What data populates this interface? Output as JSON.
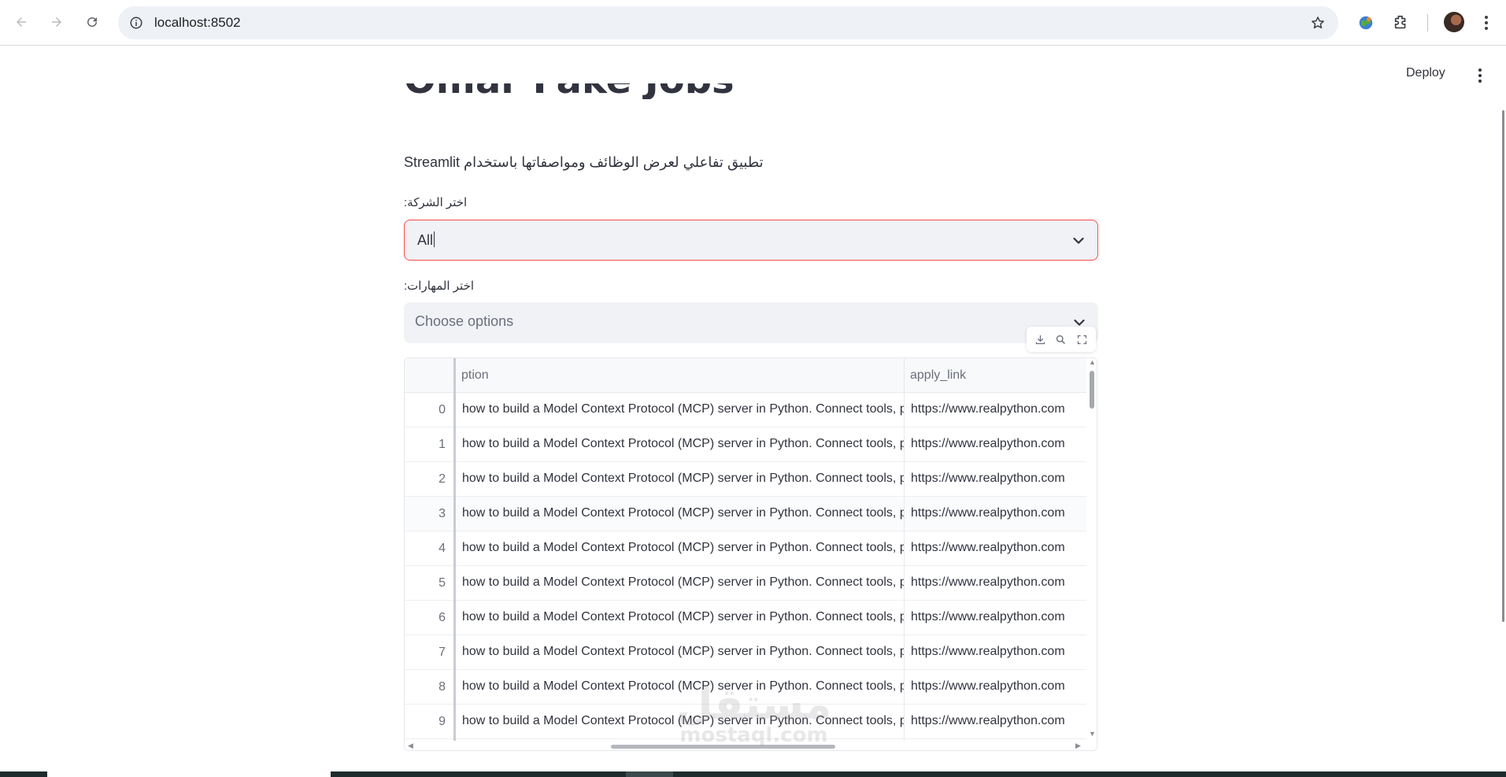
{
  "browser": {
    "url": "localhost:8502",
    "nav": {
      "back_icon": "arrow-left-icon",
      "forward_icon": "arrow-right-icon",
      "reload_icon": "reload-icon"
    }
  },
  "app_header": {
    "deploy_label": "Deploy"
  },
  "main": {
    "title": "Omar Fake Jobs",
    "subtitle": "تطبيق تفاعلي لعرض الوظائف ومواصفاتها باستخدام Streamlit",
    "company_select": {
      "label": ":اختر الشركة",
      "value": "All"
    },
    "skills_select": {
      "label": ":اختر المهارات",
      "placeholder": "Choose options"
    }
  },
  "dataframe": {
    "toolbar": [
      "download-icon",
      "search-icon",
      "fullscreen-icon"
    ],
    "columns": [
      "ption",
      "apply_link"
    ],
    "rows": [
      {
        "index": "0",
        "description": "how to build a Model Context Protocol (MCP) server in Python. Connect tools, p",
        "apply_link": "https://www.realpython.com"
      },
      {
        "index": "1",
        "description": "how to build a Model Context Protocol (MCP) server in Python. Connect tools, p",
        "apply_link": "https://www.realpython.com"
      },
      {
        "index": "2",
        "description": "how to build a Model Context Protocol (MCP) server in Python. Connect tools, p",
        "apply_link": "https://www.realpython.com"
      },
      {
        "index": "3",
        "description": "how to build a Model Context Protocol (MCP) server in Python. Connect tools, p",
        "apply_link": "https://www.realpython.com"
      },
      {
        "index": "4",
        "description": "how to build a Model Context Protocol (MCP) server in Python. Connect tools, p",
        "apply_link": "https://www.realpython.com"
      },
      {
        "index": "5",
        "description": "how to build a Model Context Protocol (MCP) server in Python. Connect tools, p",
        "apply_link": "https://www.realpython.com"
      },
      {
        "index": "6",
        "description": "how to build a Model Context Protocol (MCP) server in Python. Connect tools, p",
        "apply_link": "https://www.realpython.com"
      },
      {
        "index": "7",
        "description": "how to build a Model Context Protocol (MCP) server in Python. Connect tools, p",
        "apply_link": "https://www.realpython.com"
      },
      {
        "index": "8",
        "description": "how to build a Model Context Protocol (MCP) server in Python. Connect tools, p",
        "apply_link": "https://www.realpython.com"
      },
      {
        "index": "9",
        "description": "how to build a Model Context Protocol (MCP) server in Python. Connect tools, p",
        "apply_link": "https://www.realpython.com"
      }
    ]
  },
  "watermark": {
    "arabic": "مستقل",
    "latin": "mostaql.com"
  },
  "colors": {
    "accent_focus": "#ff4b4b",
    "input_bg": "#f0f2f6",
    "text": "#31333f"
  }
}
